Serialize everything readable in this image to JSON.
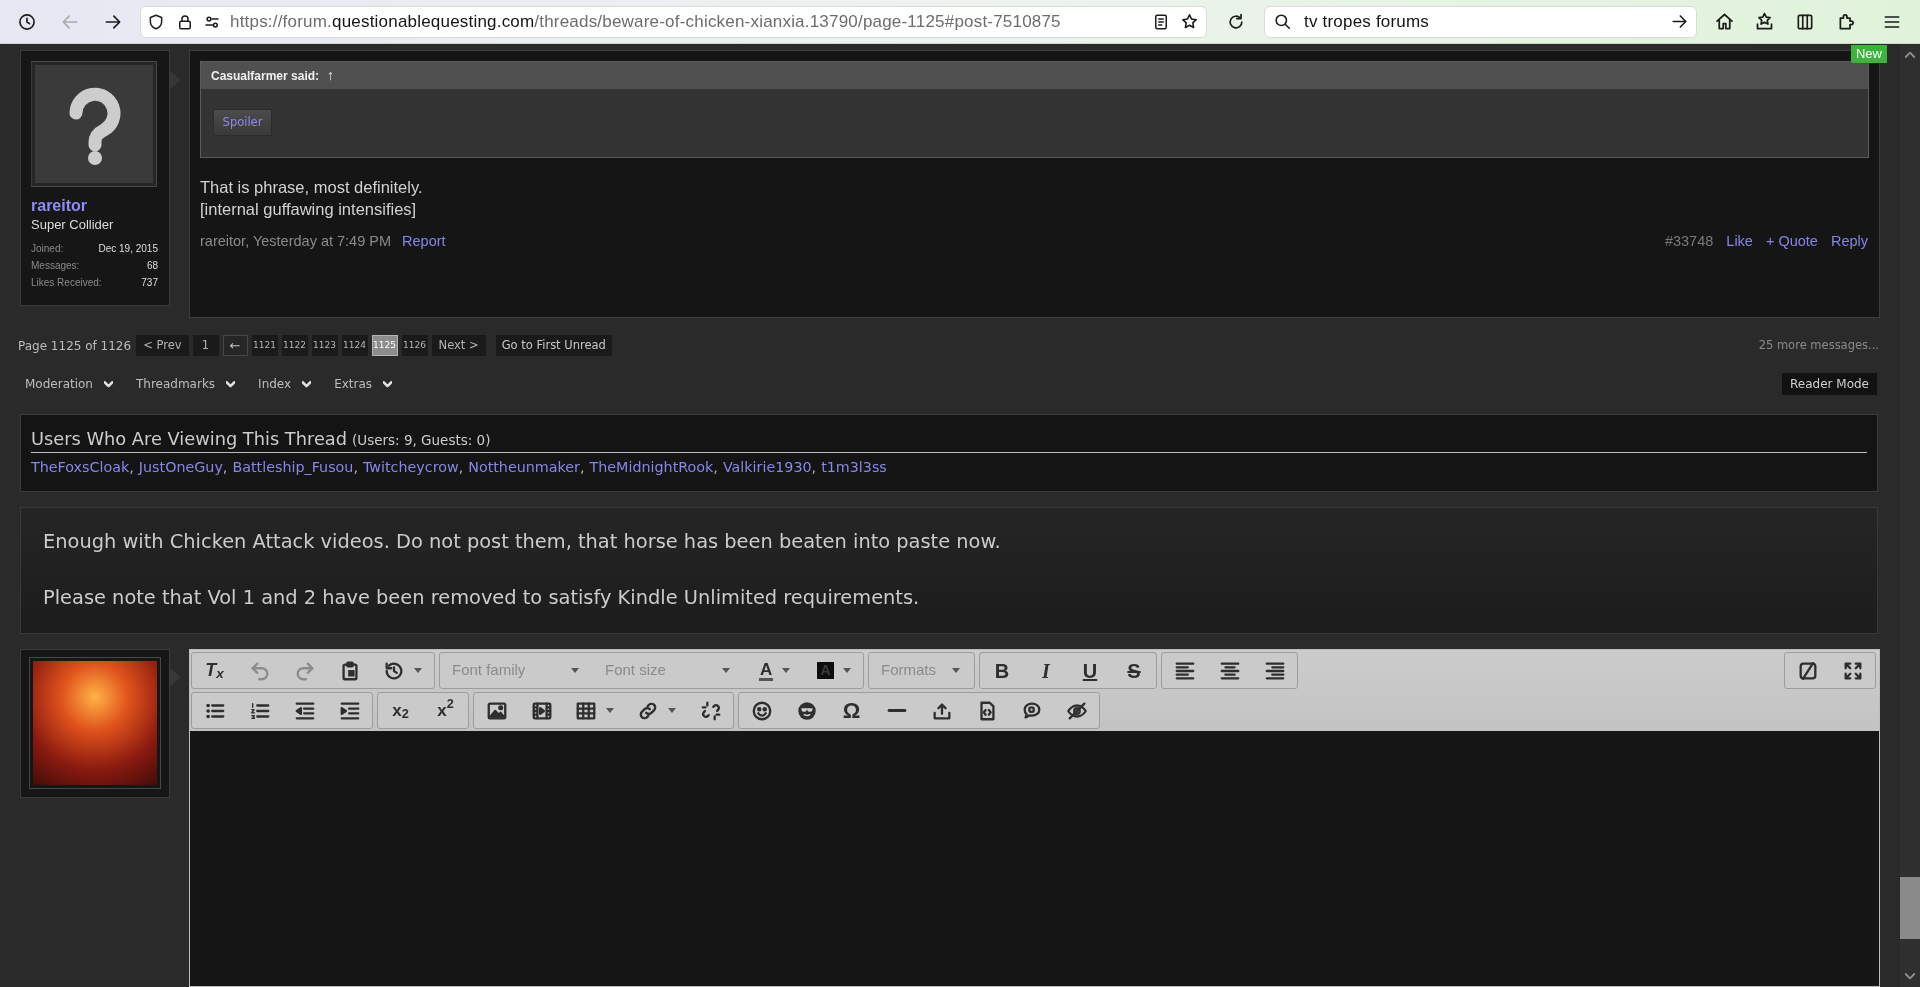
{
  "browser": {
    "back": {
      "disabled": true
    },
    "url": {
      "prefix": "https://forum.",
      "domain": "questionablequesting.com",
      "path": "/threads/beware-of-chicken-xianxia.13790/page-1125#post-7510875"
    },
    "search_value": "tv tropes forums"
  },
  "post": {
    "author": {
      "name": "rareitor",
      "title": "Super Collider",
      "stats": [
        {
          "label": "Joined:",
          "value": "Dec 19, 2015"
        },
        {
          "label": "Messages:",
          "value": "68"
        },
        {
          "label": "Likes Received:",
          "value": "737"
        }
      ]
    },
    "badge": "New",
    "quote": {
      "attribution": "Casualfarmer said:",
      "jump": "↑",
      "spoiler": "Spoiler"
    },
    "body": [
      "That is phrase, most definitely.",
      "[internal guffawing intensifies]"
    ],
    "meta": "rareitor, Yesterday at 7:49 PM",
    "report": "Report",
    "number": "#33748",
    "actions": [
      "Like",
      "+ Quote",
      "Reply"
    ]
  },
  "pagination": {
    "label": "Page 1125 of 1126",
    "pages": [
      {
        "label": "< Prev",
        "kind": "link",
        "selected": false
      },
      {
        "label": "1",
        "kind": "page",
        "selected": false
      },
      {
        "label": "←",
        "kind": "jump",
        "selected": false
      },
      {
        "label": "1121",
        "kind": "compact",
        "selected": false
      },
      {
        "label": "1122",
        "kind": "compact",
        "selected": false
      },
      {
        "label": "1123",
        "kind": "compact",
        "selected": false
      },
      {
        "label": "1124",
        "kind": "compact",
        "selected": false
      },
      {
        "label": "1125",
        "kind": "compact",
        "selected": true
      },
      {
        "label": "1126",
        "kind": "compact",
        "selected": false
      },
      {
        "label": "Next >",
        "kind": "link",
        "selected": false
      }
    ],
    "first_unread": "Go to First Unread",
    "more": "25 more messages..."
  },
  "thread_menu": [
    {
      "label": "Moderation"
    },
    {
      "label": "Threadmarks"
    },
    {
      "label": "Index"
    },
    {
      "label": "Extras"
    }
  ],
  "reader_mode": "Reader Mode",
  "viewers": {
    "title": "Users Who Are Viewing This Thread",
    "count": "(Users: 9, Guests: 0)",
    "separator": ",",
    "users": [
      "TheFoxsCloak",
      "JustOneGuy",
      "Battleship_Fusou",
      "Twitcheycrow",
      "Nottheunmaker",
      "TheMidnightRook",
      "Valkirie1930",
      "t1m3l3ss"
    ]
  },
  "notice": [
    "Enough with Chicken Attack videos. Do not post them, that horse has been beaten into paste now.",
    "Please note that Vol 1 and 2 have been removed to satisfy Kindle Unlimited requirements."
  ],
  "editor": {
    "clear_format": "T$_{x}$",
    "undo": {
      "disabled": true
    },
    "redo": {
      "disabled": true
    },
    "font_family": "Font family",
    "font_size": "Font size",
    "text_color": "A",
    "background_color": "A",
    "formats": "Formats",
    "bold": "B",
    "italic": "I",
    "underline": "U",
    "strikethrough": "S",
    "subscript": "x$_{2}$",
    "superscript": "x$^{2}$",
    "special_character": "Ω"
  }
}
